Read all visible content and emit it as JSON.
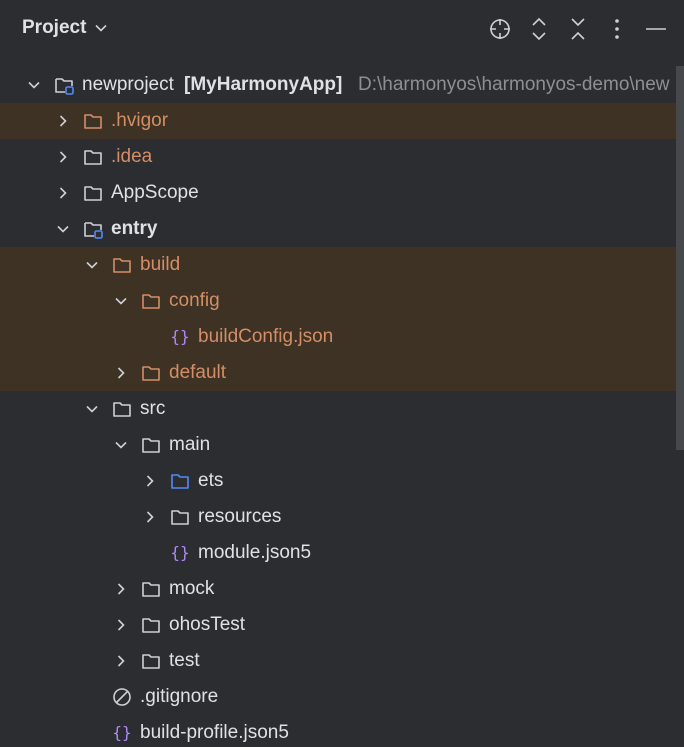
{
  "header": {
    "title": "Project",
    "tools": [
      "locate-icon",
      "expand-all-icon",
      "collapse-all-icon",
      "more-options-icon",
      "minimize-icon"
    ]
  },
  "tree": [
    {
      "name": "newproject",
      "module": "[MyHarmonyApp]",
      "path": "D:\\harmonyos\\harmonyos-demo\\new",
      "depth": 0,
      "state": "expanded",
      "icon": "module-folder-icon",
      "style": "normal",
      "bg": "normal"
    },
    {
      "name": ".hvigor",
      "depth": 1,
      "state": "collapsed",
      "icon": "excluded-folder-icon",
      "style": "orange",
      "bg": "excluded"
    },
    {
      "name": ".idea",
      "depth": 1,
      "state": "collapsed",
      "icon": "folder-icon",
      "style": "orange",
      "bg": "normal"
    },
    {
      "name": "AppScope",
      "depth": 1,
      "state": "collapsed",
      "icon": "folder-icon",
      "style": "normal",
      "bg": "normal"
    },
    {
      "name": "entry",
      "depth": 1,
      "state": "expanded",
      "icon": "module-folder-icon",
      "style": "bold",
      "bg": "normal"
    },
    {
      "name": "build",
      "depth": 2,
      "state": "expanded",
      "icon": "excluded-folder-icon",
      "style": "orange",
      "bg": "excluded"
    },
    {
      "name": "config",
      "depth": 3,
      "state": "expanded",
      "icon": "excluded-folder-icon",
      "style": "orange",
      "bg": "excluded"
    },
    {
      "name": "buildConfig.json",
      "depth": 4,
      "state": "leaf",
      "icon": "json-icon",
      "style": "orange",
      "bg": "excluded"
    },
    {
      "name": "default",
      "depth": 3,
      "state": "collapsed",
      "icon": "excluded-folder-icon",
      "style": "orange",
      "bg": "excluded"
    },
    {
      "name": "src",
      "depth": 2,
      "state": "expanded",
      "icon": "folder-icon",
      "style": "normal",
      "bg": "normal"
    },
    {
      "name": "main",
      "depth": 3,
      "state": "expanded",
      "icon": "folder-icon",
      "style": "normal",
      "bg": "normal"
    },
    {
      "name": "ets",
      "depth": 4,
      "state": "collapsed",
      "icon": "source-folder-icon",
      "style": "normal",
      "bg": "normal"
    },
    {
      "name": "resources",
      "depth": 4,
      "state": "collapsed",
      "icon": "folder-icon",
      "style": "normal",
      "bg": "normal"
    },
    {
      "name": "module.json5",
      "depth": 4,
      "state": "leaf",
      "icon": "json-icon",
      "style": "normal",
      "bg": "normal"
    },
    {
      "name": "mock",
      "depth": 3,
      "state": "collapsed",
      "icon": "folder-icon",
      "style": "normal",
      "bg": "normal"
    },
    {
      "name": "ohosTest",
      "depth": 3,
      "state": "collapsed",
      "icon": "folder-icon",
      "style": "normal",
      "bg": "normal"
    },
    {
      "name": "test",
      "depth": 3,
      "state": "collapsed",
      "icon": "folder-icon",
      "style": "normal",
      "bg": "normal"
    },
    {
      "name": ".gitignore",
      "depth": 2,
      "state": "leaf",
      "icon": "ignore-file-icon",
      "style": "normal",
      "bg": "normal"
    },
    {
      "name": "build-profile.json5",
      "depth": 2,
      "state": "leaf",
      "icon": "json-icon",
      "style": "normal",
      "bg": "normal"
    }
  ],
  "colors": {
    "background": "#2b2d30",
    "text": "#dfe1e5",
    "excluded_text": "#d48e67",
    "excluded_bg": "#3d3223",
    "muted": "#8c8f94",
    "json": "#b189f5",
    "source_folder": "#548af7"
  }
}
